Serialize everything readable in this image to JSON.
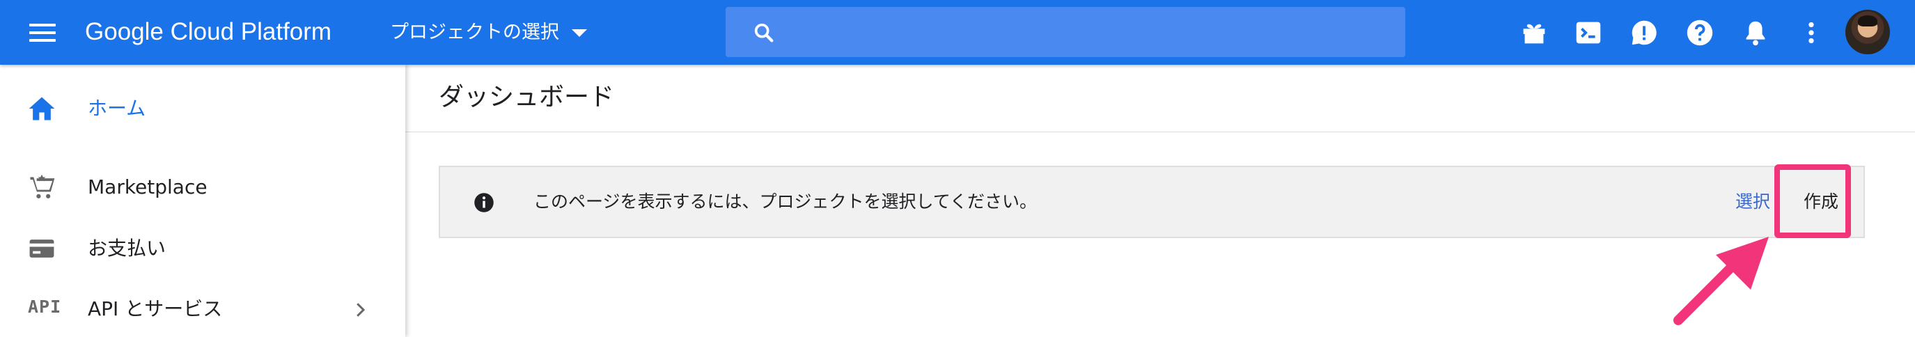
{
  "header": {
    "app_title": "Google Cloud Platform",
    "project_picker_label": "プロジェクトの選択",
    "search_placeholder": "",
    "brand_color": "#1a73e8",
    "icons": [
      "menu-icon",
      "search-icon",
      "gift-icon",
      "cloud-shell-icon",
      "feedback-icon",
      "help-icon",
      "notifications-icon",
      "more-vert-icon",
      "avatar"
    ]
  },
  "sidebar": {
    "items": [
      {
        "label": "ホーム",
        "icon": "home-icon",
        "active": true
      },
      {
        "label": "Marketplace",
        "icon": "marketplace-cart-icon"
      },
      {
        "label": "お支払い",
        "icon": "billing-card-icon"
      },
      {
        "label": "API とサービス",
        "icon": "api-icon",
        "icon_text": "API",
        "has_submenu": true
      }
    ]
  },
  "main": {
    "page_title": "ダッシュボード",
    "banner": {
      "message": "このページを表示するには、プロジェクトを選択してください。",
      "select_label": "選択",
      "create_label": "作成"
    }
  },
  "annotation": {
    "highlight_color": "#f2347a",
    "target": "create-button"
  }
}
